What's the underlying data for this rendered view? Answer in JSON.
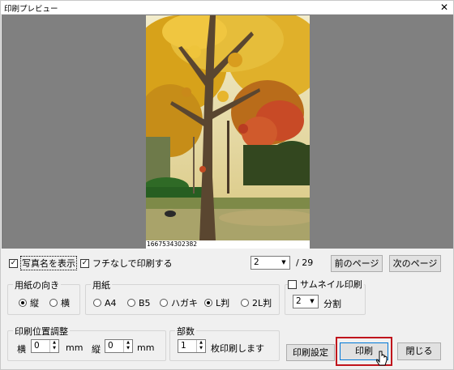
{
  "window": {
    "title": "印刷プレビュー",
    "close_glyph": "✕"
  },
  "preview": {
    "caption": "1667534302382"
  },
  "top_controls": {
    "show_name_label": "写真名を表示",
    "borderless_label": "フチなしで印刷する",
    "page_current": "2",
    "page_total": "/ 29",
    "prev_button": "前のページ",
    "next_button": "次のページ"
  },
  "orientation": {
    "title": "用紙の向き",
    "options": [
      "縦",
      "横"
    ],
    "selected": "縦"
  },
  "paper": {
    "title": "用紙",
    "options": [
      "A4",
      "B5",
      "ハガキ",
      "L判",
      "2L判"
    ],
    "selected": "L判"
  },
  "thumbnail": {
    "title": "サムネイル印刷",
    "split_value": "2",
    "split_unit": "分割"
  },
  "position": {
    "title": "印刷位置調整",
    "h_label": "横",
    "h_value": "0",
    "v_label": "縦",
    "v_value": "0",
    "unit": "mm"
  },
  "copies": {
    "title": "部数",
    "value": "1",
    "suffix": "枚印刷します"
  },
  "buttons": {
    "settings": "印刷設定",
    "print": "印刷",
    "close": "閉じる"
  },
  "colors": {
    "highlight": "#c0141c",
    "preview_bg": "#808080"
  }
}
